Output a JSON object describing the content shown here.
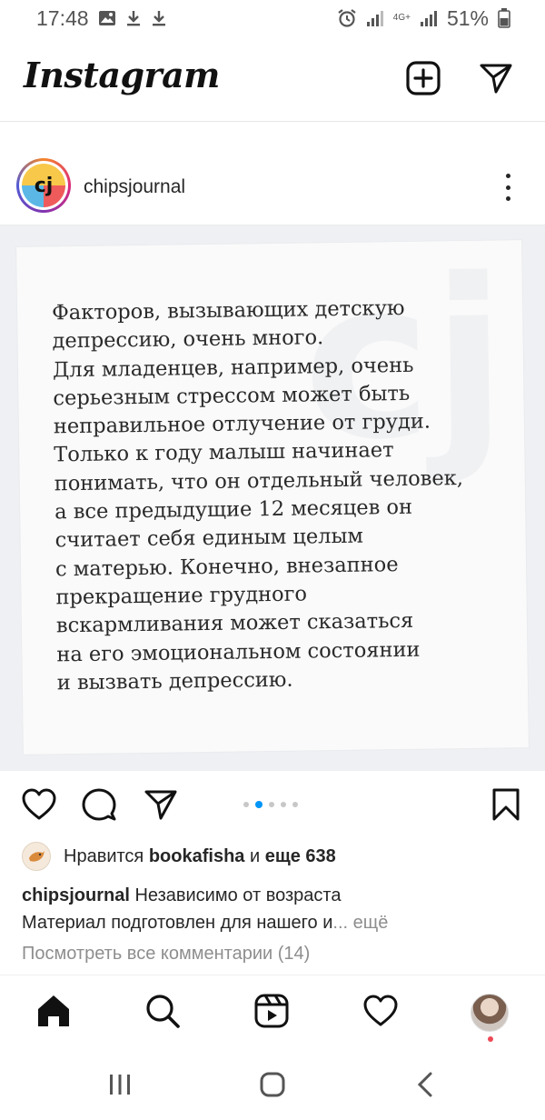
{
  "status_bar": {
    "time": "17:48",
    "network_label": "4G+",
    "battery_percent": "51%"
  },
  "header": {
    "logo_text": "Instagram",
    "icons": [
      "new-post-icon",
      "direct-message-icon"
    ]
  },
  "post": {
    "username": "chipsjournal",
    "avatar_letters": "cj",
    "watermark_letters": "cj",
    "image_text": "Факторов, вызывающих детскую\nдепрессию, очень много.\nДля младенцев, например, очень\nсерьезным стрессом может быть\nнеправильное отлучение от груди.\nТолько к году малыш начинает\nпонимать, что он отдельный человек,\nа все предыдущие 12 месяцев он\nсчитает себя единым целым\nс матерью. Конечно, внезапное\nпрекращение грудного\nвскармливания может сказаться\nна его эмоциональном состоянии\nи вызвать депрессию.",
    "carousel": {
      "count": 5,
      "active_index": 1
    },
    "likes": {
      "prefix": "Нравится",
      "user": "bookafisha",
      "connector": "и",
      "others": "еще 638"
    },
    "caption": {
      "username": "chipsjournal",
      "line1": "Независимо от возраста",
      "line2": "Материал подготовлен для нашего и",
      "ellipsis": "...",
      "more": "ещё"
    },
    "comments_link": "Посмотреть все комментарии (14)"
  },
  "bottom_nav": {
    "items": [
      "home-icon",
      "search-icon",
      "reels-icon",
      "activity-heart-icon",
      "profile-avatar"
    ]
  },
  "colors": {
    "accent_blue": "#0095f6",
    "notification_red": "#ed4956",
    "text_primary": "#262626",
    "text_muted": "#8e8e8e"
  }
}
